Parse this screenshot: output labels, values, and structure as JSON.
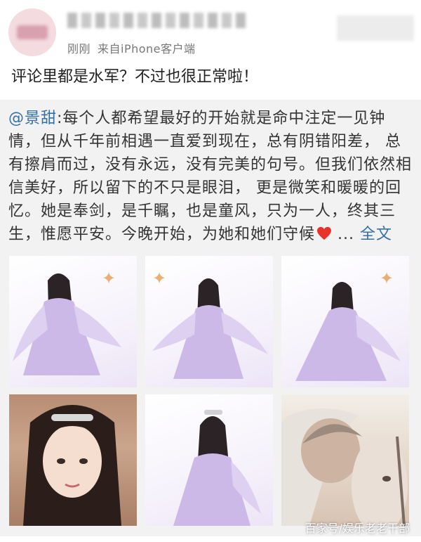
{
  "header": {
    "time": "刚刚",
    "source": "来自iPhone客户端"
  },
  "post": {
    "text": "评论里都是水军？不过也很正常啦！"
  },
  "repost": {
    "mention": "@景甜",
    "text": ":每个人都希望最好的开始就是命中注定一见钟情，但从千年前相遇一直爱到现在，总有阴错阳差， 总有擦肩而过，没有永远，没有完美的句号。但我们依然相信美好，所以留下的不只是眼泪， 更是微笑和暖暖的回忆。她是奉剑，是千瞩，也是童风，只为一人，终其三生，惟愿平安。今晚开始，为她和她们守候",
    "ellipsis": " ... ",
    "more_label": "全文",
    "heart_color": "#e8322c"
  },
  "images": [
    {
      "kind": "scene"
    },
    {
      "kind": "scene"
    },
    {
      "kind": "scene"
    },
    {
      "kind": "portrait"
    },
    {
      "kind": "scene"
    },
    {
      "kind": "portrait"
    }
  ],
  "watermark": "百家号/娱乐老老干部",
  "colors": {
    "link": "#3770a8",
    "repost_bg": "#f2f2f2",
    "dress": "#c8b6e6"
  }
}
